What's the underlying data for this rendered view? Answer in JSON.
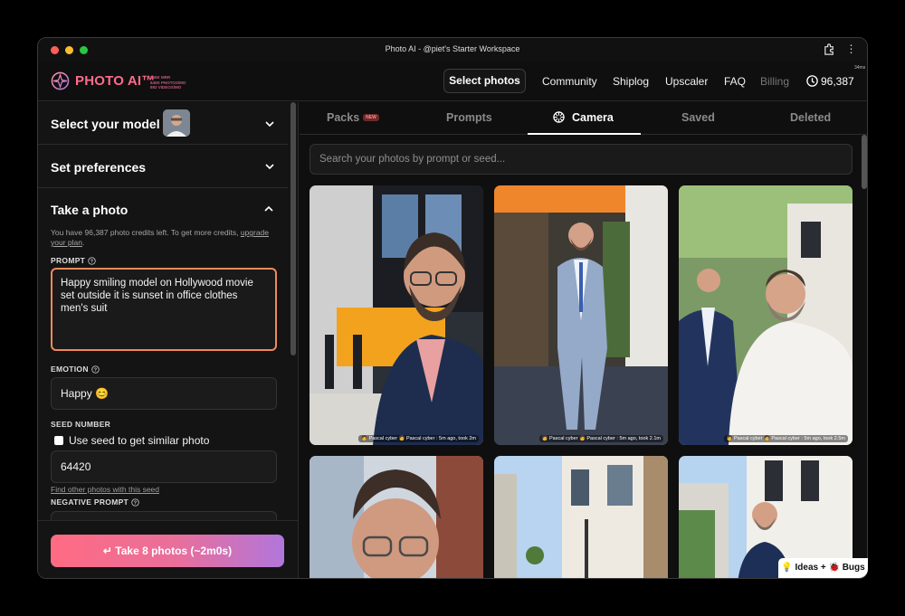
{
  "window": {
    "title": "Photo AI - @piet's Starter Workspace",
    "timer": "34ms"
  },
  "header": {
    "logo_text": "PHOTO AI™",
    "logo_stats": [
      "$55K MRR",
      "640K PHOTOS/MO",
      "892 VIDEOS/MO"
    ],
    "nav": {
      "select_photos": "Select photos",
      "community": "Community",
      "shiplog": "Shiplog",
      "upscaler": "Upscaler",
      "faq": "FAQ",
      "billing": "Billing"
    },
    "credits": "96,387"
  },
  "sidebar": {
    "select_model": "Select your model",
    "set_preferences": "Set preferences",
    "take_photo": "Take a photo",
    "credits_info": "You have 96,387 photo credits left. To get more credits,",
    "upgrade_link": "upgrade your plan",
    "prompt_label": "PROMPT",
    "prompt_value": "Happy smiling model on Hollywood movie set outside it is sunset in office clothes men's suit",
    "emotion_label": "EMOTION",
    "emotion_value": "Happy 😊",
    "seed_label": "SEED NUMBER",
    "seed_checkbox": "Use seed to get similar photo",
    "seed_value": "64420",
    "seed_link": "Find other photos with this seed",
    "negative_label": "NEGATIVE PROMPT",
    "take_button": "↵ Take 8 photos (~2m0s)"
  },
  "main": {
    "tabs": {
      "packs": "Packs",
      "packs_badge": "NEW",
      "prompts": "Prompts",
      "camera": "Camera",
      "saved": "Saved",
      "deleted": "Deleted"
    },
    "active_tab": "Camera",
    "search_placeholder": "Search your photos by prompt or seed...",
    "photos": [
      {
        "caption": "🧑 Pascal cyber 🧑 Pascal cyber : 5m ago, took 2m"
      },
      {
        "caption": "🧑 Pascal cyber 🧑 Pascal cyber : 5m ago, took 2.1m"
      },
      {
        "caption": "🧑 Pascal cyber 🧑 Pascal cyber : 5m ago, took 2.5m"
      }
    ]
  },
  "feedback_button": "💡 Ideas + 🐞 Bugs",
  "colors": {
    "accent": "#ff6b8b",
    "prompt_border": "#f08a5d",
    "gradient_start": "#ff6b82",
    "gradient_end": "#b176dc"
  }
}
